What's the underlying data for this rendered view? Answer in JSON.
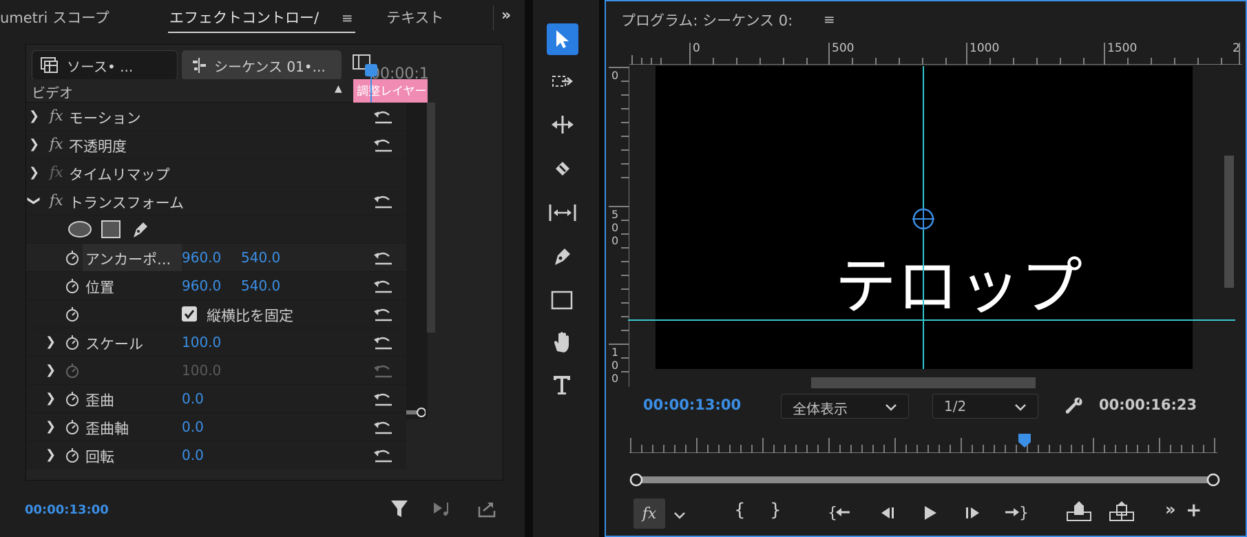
{
  "tabs": [
    {
      "label": "umetri スコープ"
    },
    {
      "label": "エフェクトコントロー/"
    },
    {
      "label": "テキスト"
    }
  ],
  "effect_controls": {
    "source_button": "ソース• ...",
    "sequence_button": "シーケンス 01•...",
    "header_time": "00:00:1",
    "video_section": "ビデオ",
    "clip_label": "調整レイヤー",
    "rows": [
      {
        "label": "モーション"
      },
      {
        "label": "不透明度"
      },
      {
        "label": "タイムリマップ"
      },
      {
        "label": "トランスフォーム"
      }
    ],
    "props": {
      "anchor": {
        "label": "アンカーポ...",
        "x": "960.0",
        "y": "540.0"
      },
      "position": {
        "label": "位置",
        "x": "960.0",
        "y": "540.0"
      },
      "uniform": {
        "label": "縦横比を固定",
        "checked": true
      },
      "scale": {
        "label": "スケール",
        "value": "100.0"
      },
      "scale_w": {
        "value": "100.0"
      },
      "skew": {
        "label": "歪曲",
        "value": "0.0"
      },
      "skew_axis": {
        "label": "歪曲軸",
        "value": "0.0"
      },
      "rotation": {
        "label": "回転",
        "value": "0.0"
      }
    },
    "footer_time": "00:00:13:00"
  },
  "tools": [
    "selection-tool",
    "track-select-tool",
    "ripple-edit-tool",
    "razor-tool",
    "slip-tool",
    "pen-tool",
    "rectangle-tool",
    "hand-tool",
    "type-tool"
  ],
  "program": {
    "title": "プログラム: シーケンス 0:",
    "ruler_h": [
      "0",
      "500",
      "1000",
      "1500",
      "2"
    ],
    "ruler_v_0": "0",
    "ruler_v_500": [
      "5",
      "0",
      "0"
    ],
    "ruler_v_1000": [
      "1",
      "0",
      "0"
    ],
    "caption": "テロップ",
    "current_time": "00:00:13:00",
    "zoom": "全体表示",
    "resolution": "1/2",
    "duration": "00:00:16:23"
  },
  "colors": {
    "accent": "#3b8fe6",
    "clip": "#f08cb4",
    "guide": "#33c7cf"
  }
}
